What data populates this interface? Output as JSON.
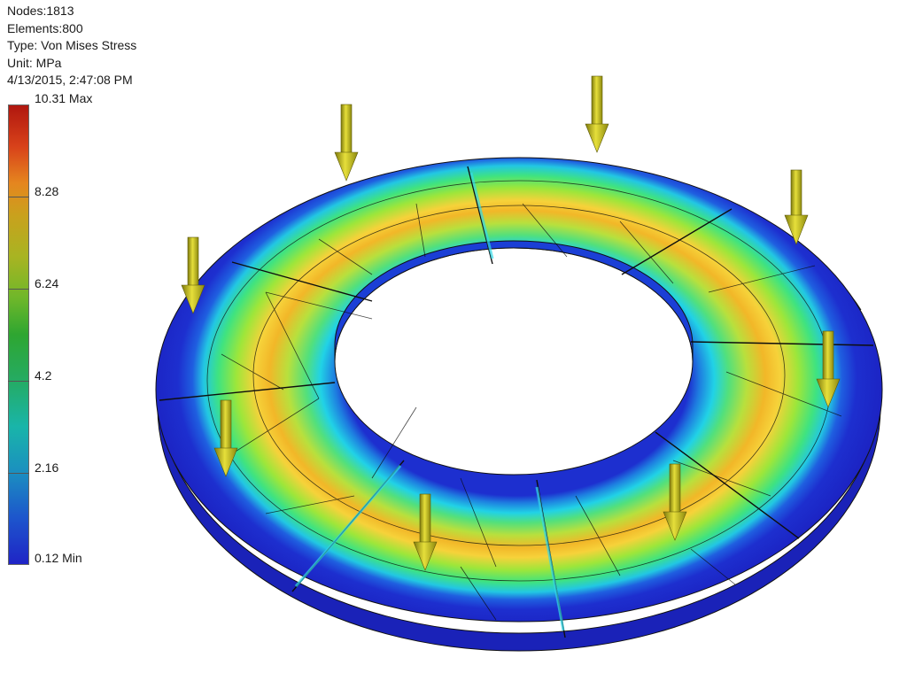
{
  "info": {
    "nodes": "Nodes:1813",
    "elements": "Elements:800",
    "type": "Type: Von Mises Stress",
    "unit": "Unit: MPa",
    "timestamp": "4/13/2015, 2:47:08 PM"
  },
  "legend": {
    "max_label": "10.31 Max",
    "min_label": "0.12 Min",
    "ticks": [
      "8.28",
      "6.24",
      "4.2",
      "2.16"
    ],
    "colors": {
      "max": "#b0170f",
      "high": "#e5861f",
      "mid": "#2ea631",
      "low": "#19b5a9",
      "min": "#1f24c6"
    }
  },
  "model": {
    "segments": 8,
    "load_arrows": 8,
    "arrow_color": "#c9c31a"
  }
}
